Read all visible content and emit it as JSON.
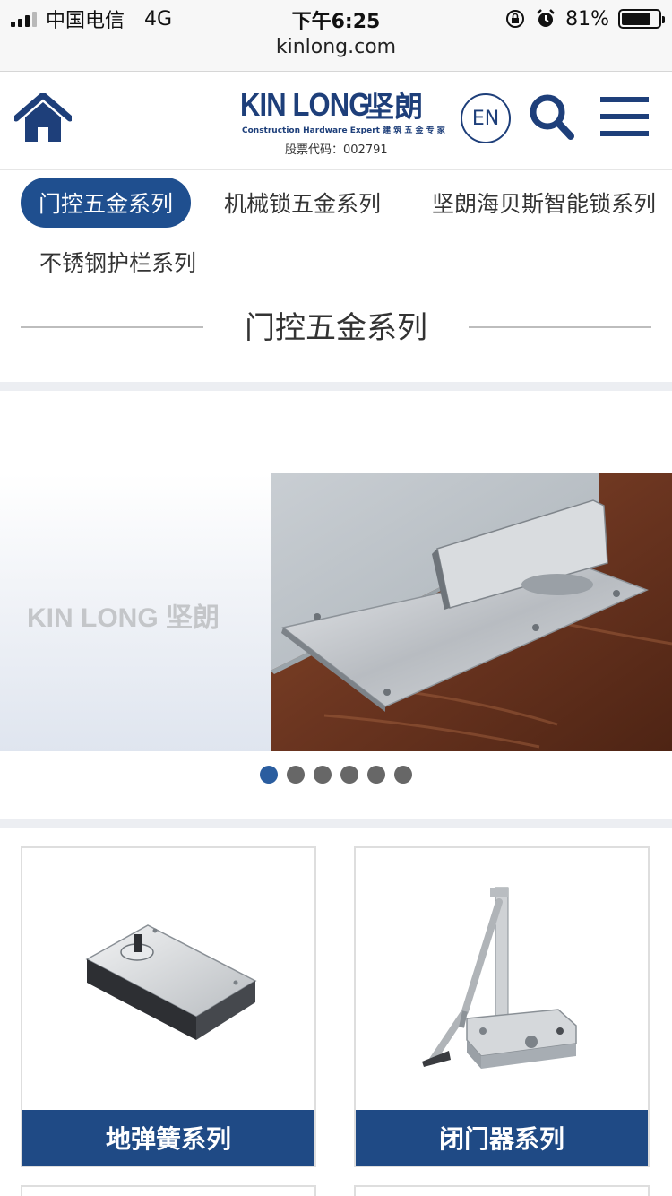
{
  "status_bar": {
    "carrier": "中国电信",
    "network": "4G",
    "time": "下午6:25",
    "battery_percent": "81%",
    "battery_level": 0.81,
    "url": "kinlong.com"
  },
  "header": {
    "logo_en": "KIN LONG",
    "logo_cn": "坚朗",
    "logo_subtitle": "Construction Hardware Expert 建 筑 五 金 专 家",
    "stock_code": "股票代码：002791",
    "lang_button": "EN",
    "brand_color": "#1e3f7a"
  },
  "tabs": [
    {
      "label": "门控五金系列",
      "active": true
    },
    {
      "label": "机械锁五金系列",
      "active": false
    },
    {
      "label": "坚朗海贝斯智能锁系列",
      "active": false
    },
    {
      "label": "不锈钢护栏系列",
      "active": false
    }
  ],
  "section": {
    "title": "门控五金系列"
  },
  "banner": {
    "watermark": "KIN LONG 坚朗",
    "slide_count": 6,
    "active_slide": 1
  },
  "products": [
    {
      "label": "地弹簧系列",
      "icon": "floor-spring-image"
    },
    {
      "label": "闭门器系列",
      "icon": "door-closer-image"
    }
  ],
  "colors": {
    "accent": "#1f4f8f",
    "card_label_bg": "#1f4a85",
    "dot_active": "#2a5d9f",
    "dot_inactive": "#676767"
  }
}
